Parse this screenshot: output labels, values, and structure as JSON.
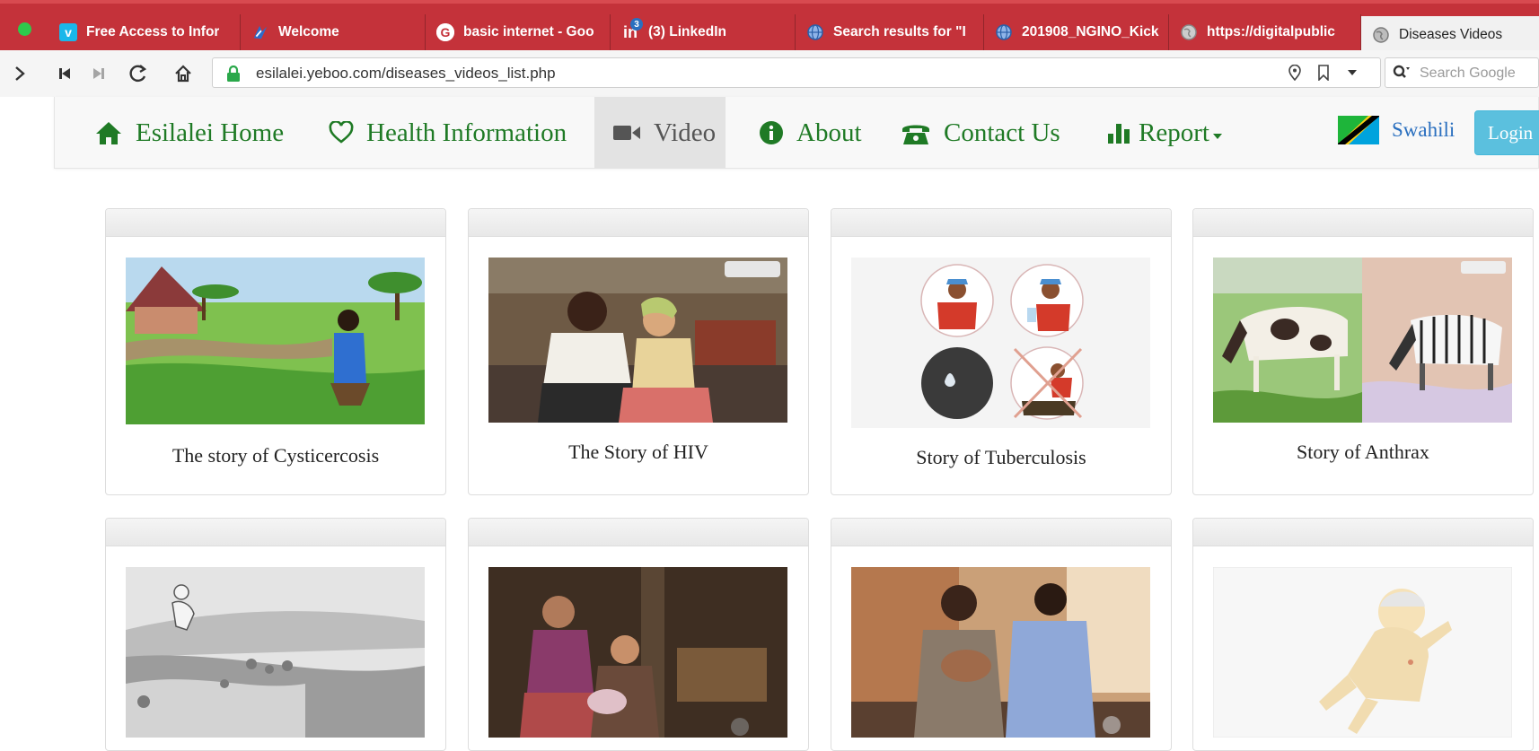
{
  "browser": {
    "tabs": [
      {
        "label": "Free Access to Infor",
        "icon": "vimeo-icon",
        "active": false
      },
      {
        "label": "Welcome",
        "icon": "welcome-icon",
        "active": false
      },
      {
        "label": "basic internet - Goo",
        "icon": "google-icon",
        "active": false
      },
      {
        "label": "(3) LinkedIn",
        "icon": "linkedin-icon",
        "badge": "3",
        "active": false
      },
      {
        "label": "Search results for \"I",
        "icon": "globe-icon",
        "active": false
      },
      {
        "label": "201908_NGINO_Kick",
        "icon": "globe-icon",
        "active": false
      },
      {
        "label": "https://digitalpublic",
        "icon": "globe-gray-icon",
        "active": false
      },
      {
        "label": "Diseases Videos",
        "icon": "globe-gray-icon",
        "active": true
      }
    ],
    "url": "esilalei.yeboo.com/diseases_videos_list.php",
    "search_placeholder": "Search Google"
  },
  "nav": {
    "items": [
      {
        "label": "Esilalei Home",
        "icon": "home-icon"
      },
      {
        "label": "Health Information",
        "icon": "heart-icon"
      },
      {
        "label": "Video",
        "icon": "video-camera-icon",
        "active": true
      },
      {
        "label": "About",
        "icon": "info-icon"
      },
      {
        "label": "Contact Us",
        "icon": "phone-icon"
      },
      {
        "label": "Report",
        "icon": "bar-chart-icon",
        "dropdown": true
      }
    ],
    "language": "Swahili",
    "login": "Login"
  },
  "videos": [
    {
      "title": "The story of Cysticercosis"
    },
    {
      "title": "The Story of HIV"
    },
    {
      "title": "Story of Tuberculosis"
    },
    {
      "title": "Story of Anthrax"
    },
    {
      "title": ""
    },
    {
      "title": ""
    },
    {
      "title": ""
    },
    {
      "title": ""
    }
  ],
  "colors": {
    "tab_bar": "#c4323a",
    "nav_link": "#1f7a25",
    "login_button": "#5bc0de",
    "language_link": "#2a6fbf"
  }
}
